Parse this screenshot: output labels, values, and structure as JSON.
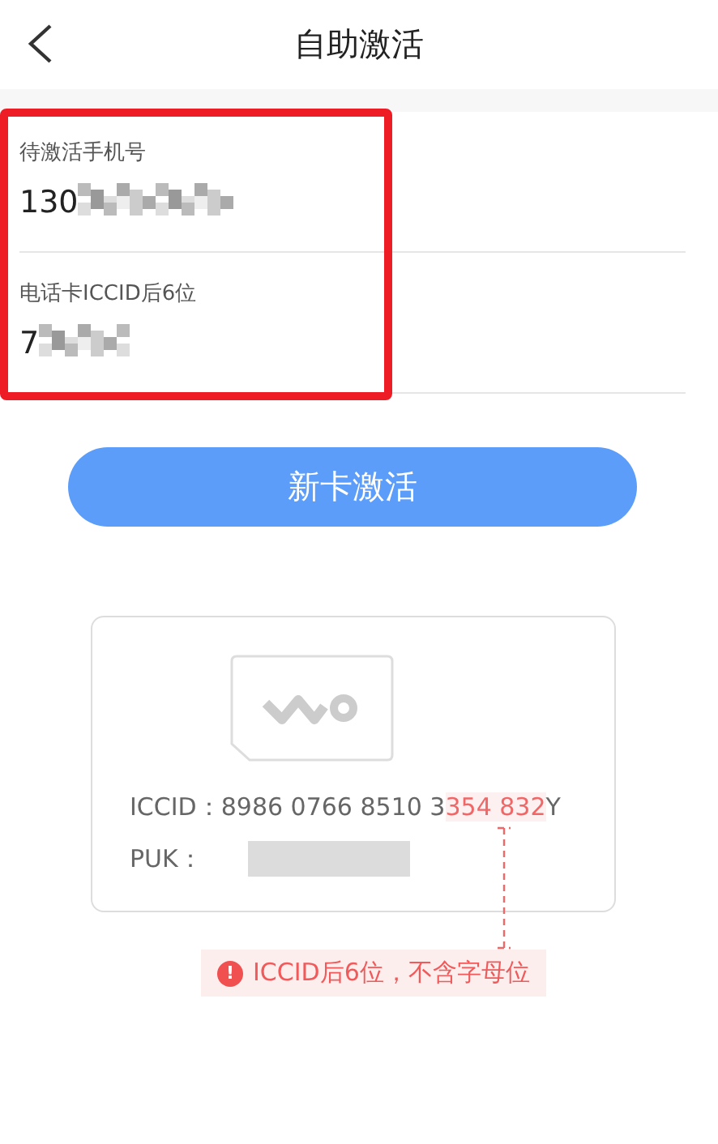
{
  "header": {
    "title": "自助激活"
  },
  "fields": [
    {
      "label": "待激活手机号",
      "value": "130"
    },
    {
      "label": "电话卡ICCID后6位",
      "value": "7"
    }
  ],
  "highlight_frame": {
    "color": "#ee1c25"
  },
  "activate_button": {
    "label": "新卡激活"
  },
  "sample_card": {
    "iccid_label": "ICCID：",
    "iccid_prefix": "8986 0766 8510 3",
    "iccid_highlight": "354 832",
    "iccid_suffix": "Y",
    "puk_label": "PUK："
  },
  "hint": {
    "icon": "!",
    "text": "ICCID后6位，不含字母位"
  }
}
